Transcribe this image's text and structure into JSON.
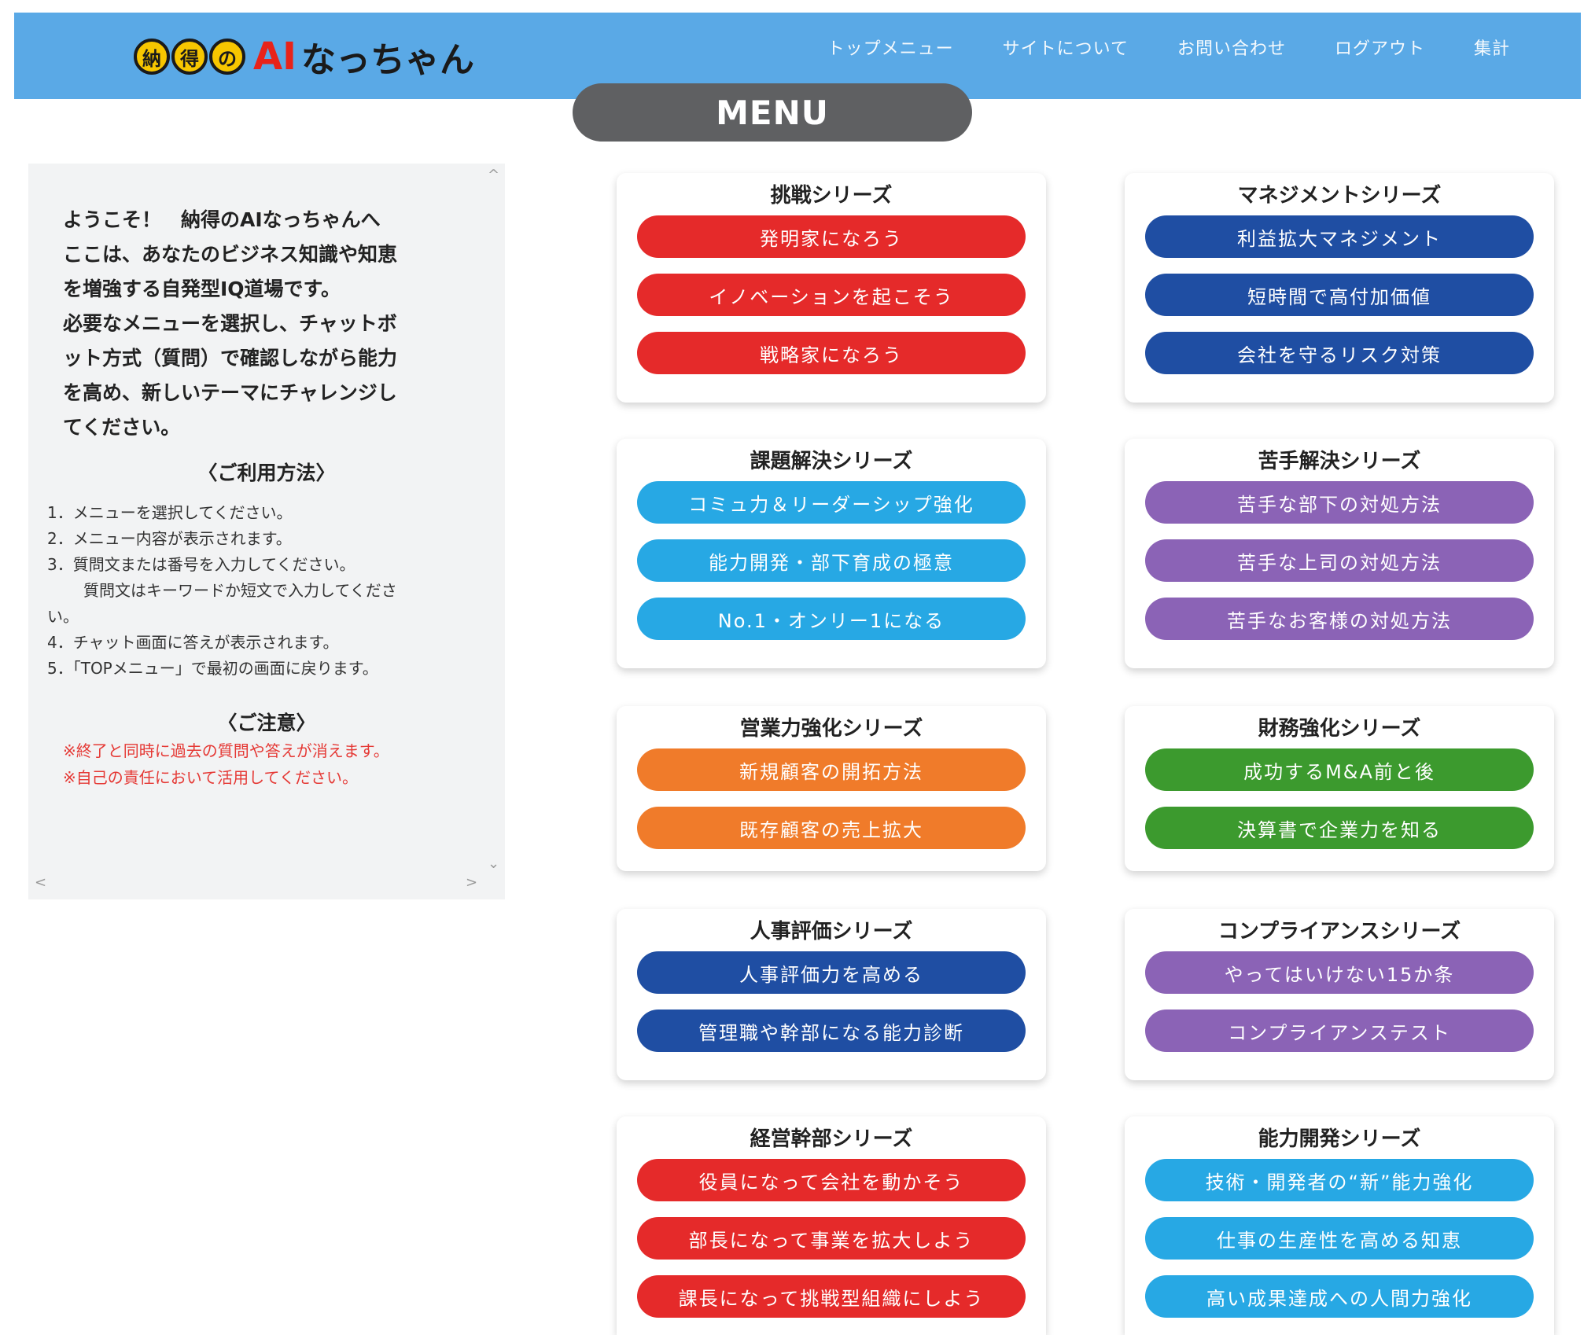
{
  "header": {
    "logo_badge": [
      "納",
      "得",
      "の"
    ],
    "logo_ai": "AI",
    "logo_name": "なっちゃん",
    "nav": [
      "トップメニュー",
      "サイトについて",
      "お問い合わせ",
      "ログアウト",
      "集計"
    ]
  },
  "menu_tab": "MENU",
  "panel": {
    "welcome_lines": [
      "ようこそ！　納得のAIなっちゃんへ",
      "ここは、あなたのビジネス知識や知恵",
      "を増強する自発型IQ道場です。",
      "必要なメニューを選択し、チャットボ",
      "ット方式（質問）で確認しながら能力",
      "を高め、新しいテーマにチャレンジし",
      "てください。"
    ],
    "usage_title": "〈ご利用方法〉",
    "usage_items": [
      "1．メニューを選択してください。",
      "2．メニュー内容が表示されます。",
      "3．質問文または番号を入力してください。",
      "質問文はキーワードか短文で入力してくださ",
      "い。",
      "4．チャット画面に答えが表示されます。",
      "5．「TOPメニュー」で最初の画面に戻ります。"
    ],
    "note_title": "〈ご注意〉",
    "note_items": [
      "※終了と同時に過去の質問や答えが消えます。",
      "※自己の責任において活用してください。"
    ],
    "scroll": {
      "up": "^",
      "down": "⌄",
      "left": "<",
      "right": ">"
    }
  },
  "series": [
    {
      "title": "挑戦シリーズ",
      "color": "#e52a2a",
      "items": [
        "発明家になろう",
        "イノベーションを起こそう",
        "戦略家になろう"
      ]
    },
    {
      "title": "マネジメントシリーズ",
      "color": "#1f4ea3",
      "items": [
        "利益拡大マネジメント",
        "短時間で高付加価値",
        "会社を守るリスク対策"
      ]
    },
    {
      "title": "課題解決シリーズ",
      "color": "#27a8e4",
      "items": [
        "コミュ力＆リーダーシップ強化",
        "能力開発・部下育成の極意",
        "No.1・オンリー1になる"
      ]
    },
    {
      "title": "苦手解決シリーズ",
      "color": "#8b63b6",
      "items": [
        "苦手な部下の対処方法",
        "苦手な上司の対処方法",
        "苦手なお客様の対処方法"
      ]
    },
    {
      "title": "営業力強化シリーズ",
      "color": "#f07b2a",
      "items": [
        "新規顧客の開拓方法",
        "既存顧客の売上拡大"
      ]
    },
    {
      "title": "財務強化シリーズ",
      "color": "#3c9a2e",
      "items": [
        "成功するM&A前と後",
        "決算書で企業力を知る"
      ]
    },
    {
      "title": "人事評価シリーズ",
      "color": "#1f4ea3",
      "items": [
        "人事評価力を高める",
        "管理職や幹部になる能力診断"
      ]
    },
    {
      "title": "コンプライアンスシリーズ",
      "color": "#8b63b6",
      "items": [
        "やってはいけない15か条",
        "コンプライアンステスト"
      ]
    },
    {
      "title": "経営幹部シリーズ",
      "color": "#e52a2a",
      "items": [
        "役員になって会社を動かそう",
        "部長になって事業を拡大しよう",
        "課長になって挑戦型組織にしよう"
      ]
    },
    {
      "title": "能力開発シリーズ",
      "color": "#27a8e4",
      "items": [
        "技術・開発者の“新”能力強化",
        "仕事の生産性を高める知恵",
        "高い成果達成への人間力強化"
      ]
    }
  ]
}
